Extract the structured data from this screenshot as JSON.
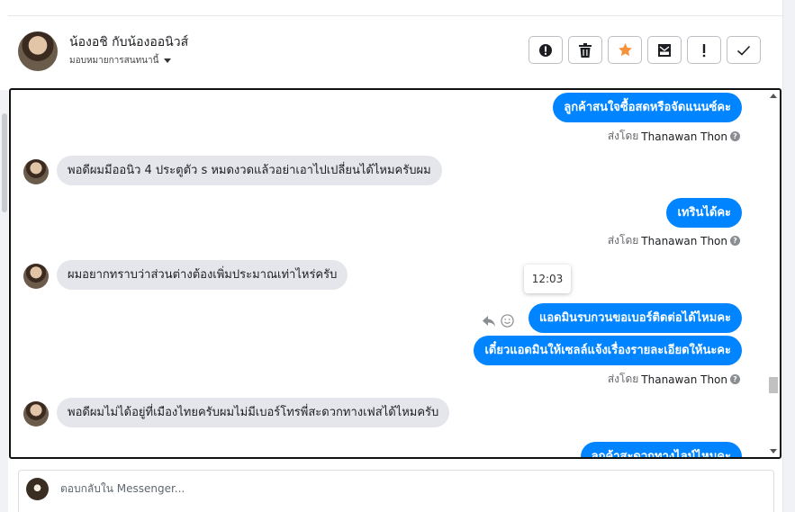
{
  "header": {
    "contact_name": "น้องอชิ กับน้องออนิวส์",
    "assign_label": "มอบหมายการสนทนานี้"
  },
  "actions": [
    {
      "name": "spam-button",
      "icon": "alert-circle-icon"
    },
    {
      "name": "delete-button",
      "icon": "trash-icon"
    },
    {
      "name": "star-button",
      "icon": "star-icon"
    },
    {
      "name": "archive-button",
      "icon": "mail-box-icon"
    },
    {
      "name": "flag-button",
      "icon": "exclamation-icon"
    },
    {
      "name": "done-button",
      "icon": "check-icon"
    }
  ],
  "colors": {
    "accent": "#0084ff",
    "star": "#f7923b",
    "incoming": "#e4e6eb"
  },
  "messages": {
    "m1": "ลูกค้าสนใจซื้อสดหรือจัดแนนซ์คะ",
    "m2": "พอดีผมมีออนิว 4 ประตูตัว s หมดงวดแล้วอย่าเอาไปเปลี่ยนได้ไหมครับผม",
    "m3": "เทรินได้คะ",
    "m4": "ผมอยากทราบว่าส่วนต่างต้องเพิ่มประมาณเท่าไหร่ครับ",
    "m5": "แอดมินรบกวนขอเบอร์ติดต่อได้ไหมคะ",
    "m6": "เดี๋ยวแอดมินให้เซลล์แจ้งเรื่องรายละเอียดให้นะคะ",
    "m7": "พอดีผมไม่ได้อยู่ที่เมืองไทยครับผมไม่มีเบอร์โทรพี่สะดวกทางเฟสได้ไหมครับ",
    "m8": "ลูกค้าสะดวกทางไลน์ไหมคะ"
  },
  "sent_by": {
    "prefix": "ส่งโดย",
    "name": "Thanawan Thon"
  },
  "tooltip_time": "12:03",
  "composer": {
    "placeholder": "ตอบกลับใน Messenger..."
  }
}
